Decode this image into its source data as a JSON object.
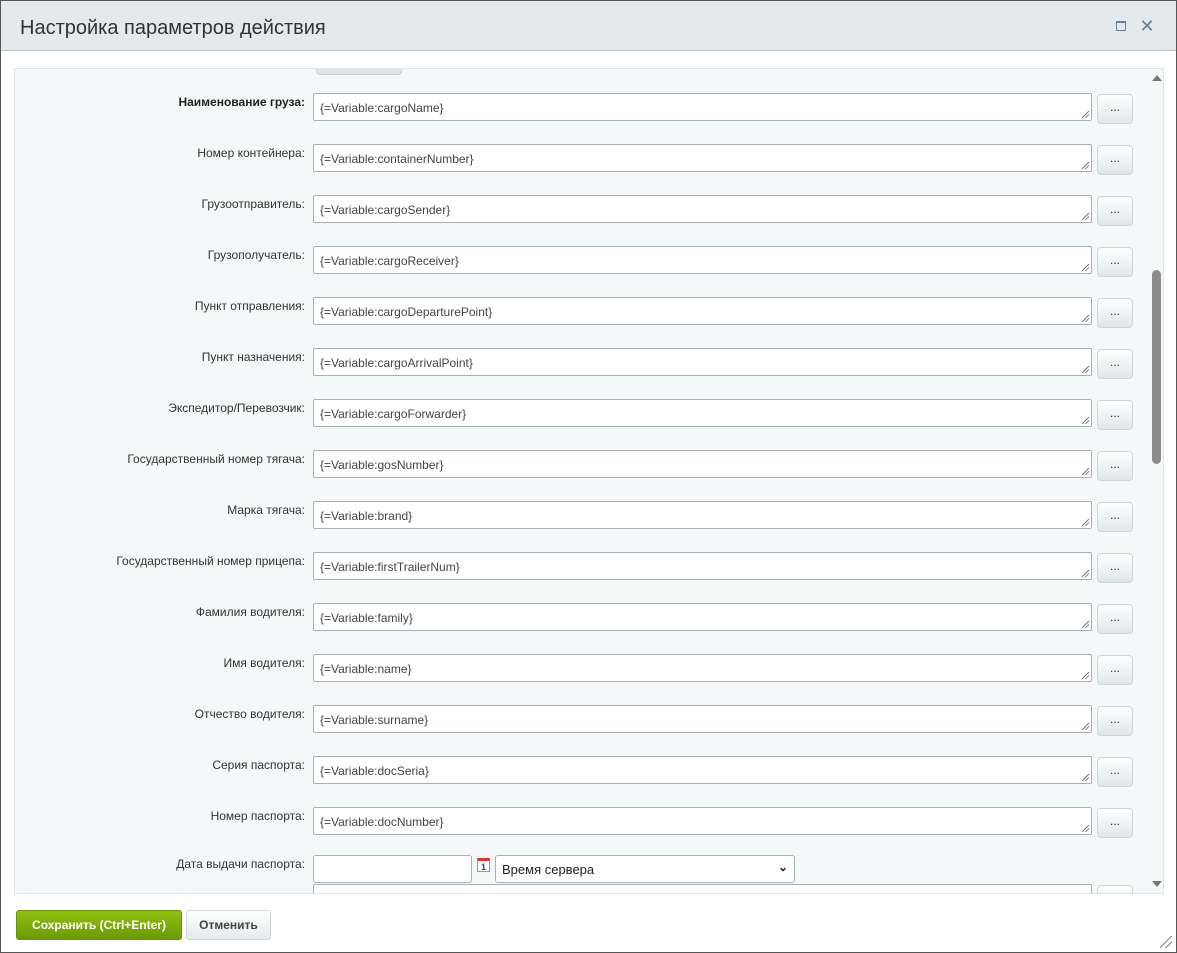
{
  "dialog": {
    "title": "Настройка параметров действия"
  },
  "fields": [
    {
      "label": "Наименование груза:",
      "value": "{=Variable:cargoName}",
      "bold": true
    },
    {
      "label": "Номер контейнера:",
      "value": "{=Variable:containerNumber}"
    },
    {
      "label": "Грузоотправитель:",
      "value": "{=Variable:cargoSender}"
    },
    {
      "label": "Грузополучатель:",
      "value": "{=Variable:cargoReceiver}"
    },
    {
      "label": "Пункт отправления:",
      "value": "{=Variable:cargoDeparturePoint}"
    },
    {
      "label": "Пункт назначения:",
      "value": "{=Variable:cargoArrivalPoint}"
    },
    {
      "label": "Экспедитор/Перевозчик:",
      "value": "{=Variable:cargoForwarder}"
    },
    {
      "label": "Государственный номер тягача:",
      "value": "{=Variable:gosNumber}"
    },
    {
      "label": "Марка тягача:",
      "value": "{=Variable:brand}"
    },
    {
      "label": "Государственный номер прицепа:",
      "value": "{=Variable:firstTrailerNum}"
    },
    {
      "label": "Фамилия водителя:",
      "value": "{=Variable:family}"
    },
    {
      "label": "Имя водителя:",
      "value": "{=Variable:name}"
    },
    {
      "label": "Отчество водителя:",
      "value": "{=Variable:surname}"
    },
    {
      "label": "Серия паспорта:",
      "value": "{=Variable:docSeria}"
    },
    {
      "label": "Номер паспорта:",
      "value": "{=Variable:docNumber}"
    }
  ],
  "picker_button": "...",
  "date_field": {
    "label": "Дата выдачи паспорта:",
    "value": "",
    "calendar_day": "1",
    "timezone": "Время сервера"
  },
  "footer": {
    "save": "Сохранить (Ctrl+Enter)",
    "cancel": "Отменить"
  }
}
